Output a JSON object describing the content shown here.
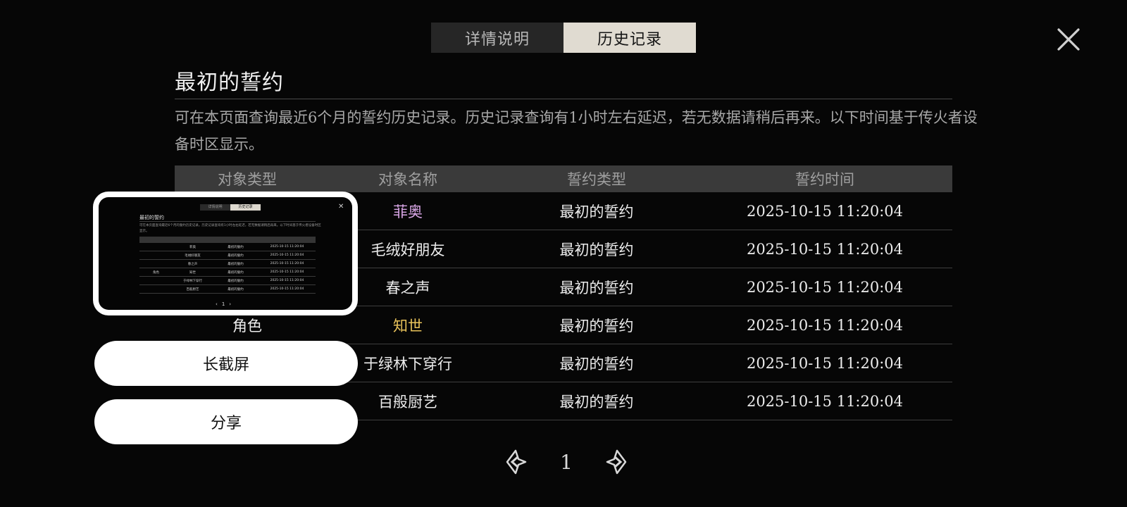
{
  "tabs": {
    "details": "详情说明",
    "history": "历史记录",
    "active": "history"
  },
  "header": {
    "title": "最初的誓约"
  },
  "description": "可在本页面查询最近6个月的誓约历史记录。历史记录查询有1小时左右延迟，若无数据请稍后再来。以下时间基于传火者设备时区显示。",
  "table": {
    "columns": [
      "对象类型",
      "对象名称",
      "誓约类型",
      "誓约时间"
    ],
    "rows": [
      {
        "type": "",
        "name": "菲奥",
        "pledge": "最初的誓约",
        "time": "2025-10-15 11:20:04",
        "name_color": "#d9a6e6"
      },
      {
        "type": "",
        "name": "毛绒好朋友",
        "pledge": "最初的誓约",
        "time": "2025-10-15 11:20:04",
        "name_color": "#ececec"
      },
      {
        "type": "",
        "name": "春之声",
        "pledge": "最初的誓约",
        "time": "2025-10-15 11:20:04",
        "name_color": "#ececec"
      },
      {
        "type": "角色",
        "name": "知世",
        "pledge": "最初的誓约",
        "time": "2025-10-15 11:20:04",
        "name_color": "#e8c25a"
      },
      {
        "type": "",
        "name": "于绿林下穿行",
        "pledge": "最初的誓约",
        "time": "2025-10-15 11:20:04",
        "name_color": "#ececec"
      },
      {
        "type": "",
        "name": "百般厨艺",
        "pledge": "最初的誓约",
        "time": "2025-10-15 11:20:04",
        "name_color": "#ececec"
      }
    ]
  },
  "pagination": {
    "page": "1"
  },
  "overlay": {
    "long_screenshot_label": "长截屏",
    "share_label": "分享"
  },
  "icons": {
    "close": "close-icon",
    "prev": "prev-page-icon",
    "next": "next-page-icon"
  },
  "colors": {
    "background": "#060606",
    "tab_active": "#e0dbd1",
    "tab_inactive": "#262626",
    "header_row": "#3a3a3a"
  }
}
